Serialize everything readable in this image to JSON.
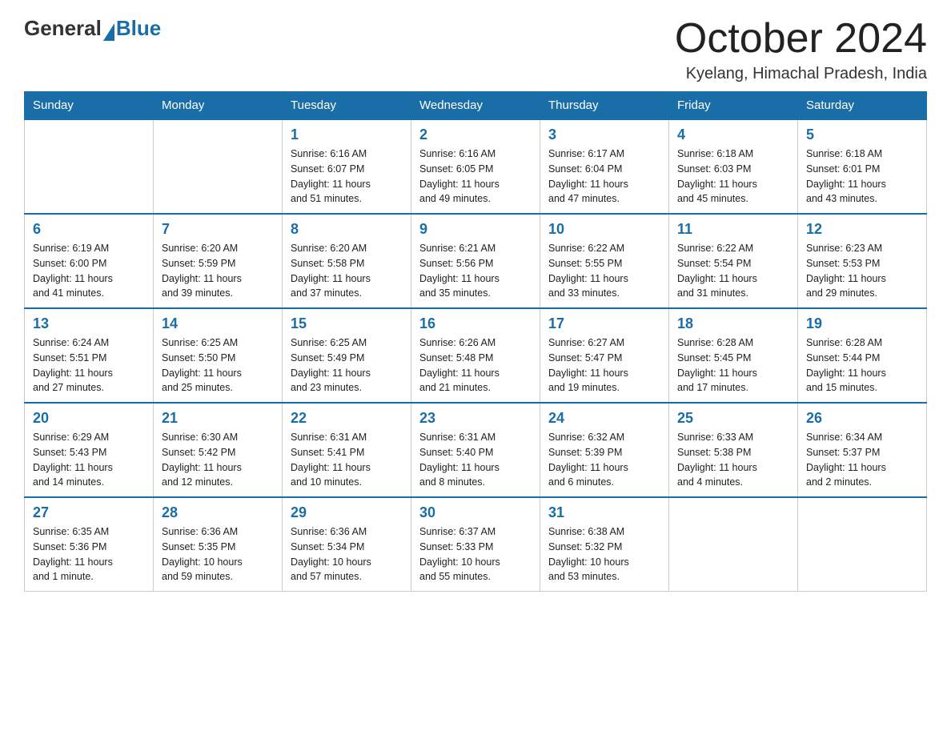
{
  "logo": {
    "general": "General",
    "blue": "Blue"
  },
  "header": {
    "month": "October 2024",
    "location": "Kyelang, Himachal Pradesh, India"
  },
  "weekdays": [
    "Sunday",
    "Monday",
    "Tuesday",
    "Wednesday",
    "Thursday",
    "Friday",
    "Saturday"
  ],
  "weeks": [
    [
      {
        "day": "",
        "info": ""
      },
      {
        "day": "",
        "info": ""
      },
      {
        "day": "1",
        "info": "Sunrise: 6:16 AM\nSunset: 6:07 PM\nDaylight: 11 hours\nand 51 minutes."
      },
      {
        "day": "2",
        "info": "Sunrise: 6:16 AM\nSunset: 6:05 PM\nDaylight: 11 hours\nand 49 minutes."
      },
      {
        "day": "3",
        "info": "Sunrise: 6:17 AM\nSunset: 6:04 PM\nDaylight: 11 hours\nand 47 minutes."
      },
      {
        "day": "4",
        "info": "Sunrise: 6:18 AM\nSunset: 6:03 PM\nDaylight: 11 hours\nand 45 minutes."
      },
      {
        "day": "5",
        "info": "Sunrise: 6:18 AM\nSunset: 6:01 PM\nDaylight: 11 hours\nand 43 minutes."
      }
    ],
    [
      {
        "day": "6",
        "info": "Sunrise: 6:19 AM\nSunset: 6:00 PM\nDaylight: 11 hours\nand 41 minutes."
      },
      {
        "day": "7",
        "info": "Sunrise: 6:20 AM\nSunset: 5:59 PM\nDaylight: 11 hours\nand 39 minutes."
      },
      {
        "day": "8",
        "info": "Sunrise: 6:20 AM\nSunset: 5:58 PM\nDaylight: 11 hours\nand 37 minutes."
      },
      {
        "day": "9",
        "info": "Sunrise: 6:21 AM\nSunset: 5:56 PM\nDaylight: 11 hours\nand 35 minutes."
      },
      {
        "day": "10",
        "info": "Sunrise: 6:22 AM\nSunset: 5:55 PM\nDaylight: 11 hours\nand 33 minutes."
      },
      {
        "day": "11",
        "info": "Sunrise: 6:22 AM\nSunset: 5:54 PM\nDaylight: 11 hours\nand 31 minutes."
      },
      {
        "day": "12",
        "info": "Sunrise: 6:23 AM\nSunset: 5:53 PM\nDaylight: 11 hours\nand 29 minutes."
      }
    ],
    [
      {
        "day": "13",
        "info": "Sunrise: 6:24 AM\nSunset: 5:51 PM\nDaylight: 11 hours\nand 27 minutes."
      },
      {
        "day": "14",
        "info": "Sunrise: 6:25 AM\nSunset: 5:50 PM\nDaylight: 11 hours\nand 25 minutes."
      },
      {
        "day": "15",
        "info": "Sunrise: 6:25 AM\nSunset: 5:49 PM\nDaylight: 11 hours\nand 23 minutes."
      },
      {
        "day": "16",
        "info": "Sunrise: 6:26 AM\nSunset: 5:48 PM\nDaylight: 11 hours\nand 21 minutes."
      },
      {
        "day": "17",
        "info": "Sunrise: 6:27 AM\nSunset: 5:47 PM\nDaylight: 11 hours\nand 19 minutes."
      },
      {
        "day": "18",
        "info": "Sunrise: 6:28 AM\nSunset: 5:45 PM\nDaylight: 11 hours\nand 17 minutes."
      },
      {
        "day": "19",
        "info": "Sunrise: 6:28 AM\nSunset: 5:44 PM\nDaylight: 11 hours\nand 15 minutes."
      }
    ],
    [
      {
        "day": "20",
        "info": "Sunrise: 6:29 AM\nSunset: 5:43 PM\nDaylight: 11 hours\nand 14 minutes."
      },
      {
        "day": "21",
        "info": "Sunrise: 6:30 AM\nSunset: 5:42 PM\nDaylight: 11 hours\nand 12 minutes."
      },
      {
        "day": "22",
        "info": "Sunrise: 6:31 AM\nSunset: 5:41 PM\nDaylight: 11 hours\nand 10 minutes."
      },
      {
        "day": "23",
        "info": "Sunrise: 6:31 AM\nSunset: 5:40 PM\nDaylight: 11 hours\nand 8 minutes."
      },
      {
        "day": "24",
        "info": "Sunrise: 6:32 AM\nSunset: 5:39 PM\nDaylight: 11 hours\nand 6 minutes."
      },
      {
        "day": "25",
        "info": "Sunrise: 6:33 AM\nSunset: 5:38 PM\nDaylight: 11 hours\nand 4 minutes."
      },
      {
        "day": "26",
        "info": "Sunrise: 6:34 AM\nSunset: 5:37 PM\nDaylight: 11 hours\nand 2 minutes."
      }
    ],
    [
      {
        "day": "27",
        "info": "Sunrise: 6:35 AM\nSunset: 5:36 PM\nDaylight: 11 hours\nand 1 minute."
      },
      {
        "day": "28",
        "info": "Sunrise: 6:36 AM\nSunset: 5:35 PM\nDaylight: 10 hours\nand 59 minutes."
      },
      {
        "day": "29",
        "info": "Sunrise: 6:36 AM\nSunset: 5:34 PM\nDaylight: 10 hours\nand 57 minutes."
      },
      {
        "day": "30",
        "info": "Sunrise: 6:37 AM\nSunset: 5:33 PM\nDaylight: 10 hours\nand 55 minutes."
      },
      {
        "day": "31",
        "info": "Sunrise: 6:38 AM\nSunset: 5:32 PM\nDaylight: 10 hours\nand 53 minutes."
      },
      {
        "day": "",
        "info": ""
      },
      {
        "day": "",
        "info": ""
      }
    ]
  ]
}
